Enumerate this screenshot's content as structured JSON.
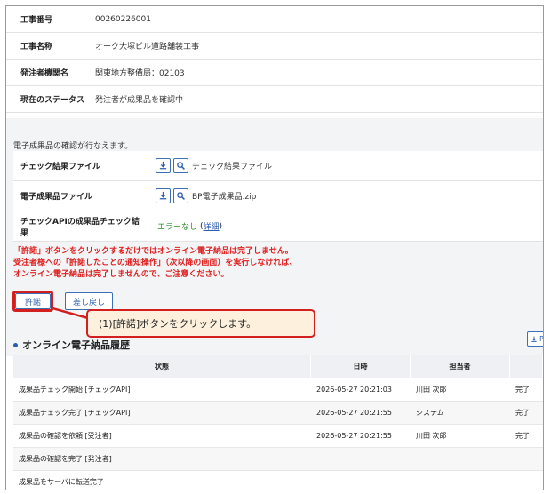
{
  "project": {
    "rows": [
      {
        "label": "工事番号",
        "value": "00260226001"
      },
      {
        "label": "工事名称",
        "value": "オーク大塚ビル道路舗装工事"
      },
      {
        "label": "発注者機関名",
        "value": "関東地方整備局：02103"
      },
      {
        "label": "現在のステータス",
        "value": "発注者が成果品を確認中"
      }
    ]
  },
  "deliverable": {
    "notice": "電子成果品の確認が行なえます。",
    "check_result_label": "チェック結果ファイル",
    "check_result_file": "チェック結果ファイル",
    "deliverable_label": "電子成果品ファイル",
    "deliverable_file": "BP電子成果品.zip",
    "api_label": "チェックAPIの成果品チェック結果",
    "api_result": "エラーなし",
    "api_detail_open": "(",
    "api_detail_link": "詳細",
    "api_detail_close": ")"
  },
  "warning": {
    "line1": "「許諾」ボタンをクリックするだけではオンライン電子納品は完了しません。",
    "line2": "受注者様への「許諾したことの通知操作」（次以降の画面）を実行しなければ、",
    "line3": "オンライン電子納品は完了しませんので、ご注意ください。"
  },
  "actions": {
    "approve_label": "許諾",
    "reject_label": "差し戻し"
  },
  "callout": {
    "text": "(1)[許諾]ボタンをクリックします。"
  },
  "history": {
    "title": "オンライン電子納品履歴",
    "export_label": "P",
    "columns": [
      "状態",
      "日時",
      "担当者",
      ""
    ],
    "rows": [
      {
        "status": "成果品チェック開始 [チェックAPI]",
        "datetime": "2026-05-27 20:21:03",
        "person": "川田 次郎",
        "result": "完了"
      },
      {
        "status": "成果品チェック完了 [チェックAPI]",
        "datetime": "2026-05-27 20:21:55",
        "person": "システム",
        "result": "完了"
      },
      {
        "status": "成果品の確認を依頼 [受注者]",
        "datetime": "2026-05-27 20:21:55",
        "person": "川田 次郎",
        "result": "完了"
      },
      {
        "status": "成果品の確認を完了 [発注者]",
        "datetime": "",
        "person": "",
        "result": ""
      },
      {
        "status": "成果品をサーバに転送完了",
        "datetime": "",
        "person": "",
        "result": ""
      }
    ]
  },
  "colors": {
    "accent": "#2a5db0",
    "warning": "#e02020",
    "highlight": "#d41f1f",
    "callout_bg": "#fdf0dc",
    "ok": "#2e8b2e"
  }
}
